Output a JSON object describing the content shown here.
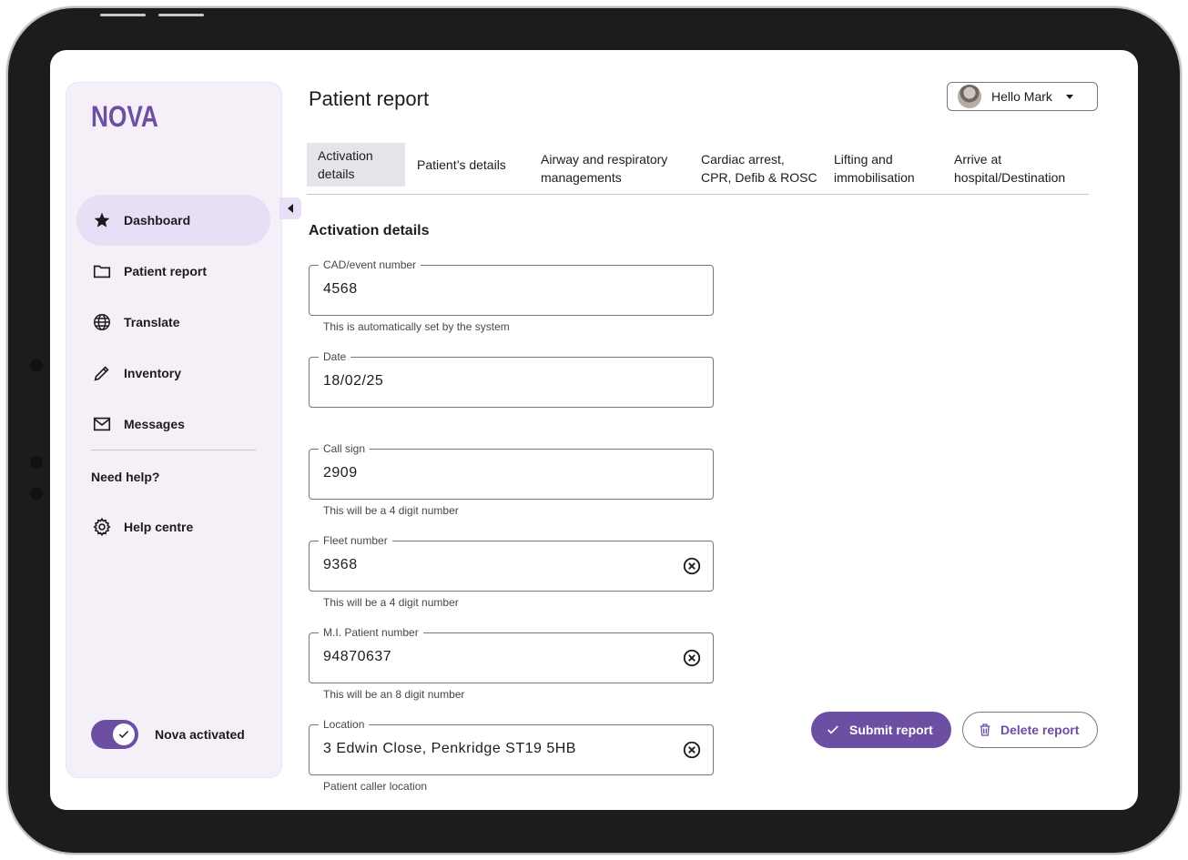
{
  "app": {
    "logo": "NOVA"
  },
  "sidebar": {
    "items": [
      {
        "label": "Dashboard",
        "icon": "star-icon",
        "active": true
      },
      {
        "label": "Patient report",
        "icon": "folder-icon"
      },
      {
        "label": "Translate",
        "icon": "globe-icon"
      },
      {
        "label": "Inventory",
        "icon": "pencil-icon"
      },
      {
        "label": "Messages",
        "icon": "mail-icon"
      }
    ],
    "need_help": "Need help?",
    "help_centre": {
      "label": "Help centre",
      "icon": "gear-icon"
    },
    "toggle": {
      "label": "Nova activated",
      "on": true
    }
  },
  "header": {
    "title": "Patient report",
    "user_greeting": "Hello Mark"
  },
  "tabs": [
    {
      "label": "Activation\ndetails",
      "active": true
    },
    {
      "label": "Patient’s details"
    },
    {
      "label": "Airway and respiratory\nmanagements"
    },
    {
      "label": "Cardiac arrest,\nCPR, Defib & ROSC"
    },
    {
      "label": "Lifting and\nimmobilisation"
    },
    {
      "label": "Arrive at\nhospital/Destination"
    }
  ],
  "section_title": "Activation details",
  "fields": {
    "cad": {
      "label": "CAD/event number",
      "value": "4568",
      "helper": "This is automatically set by the system"
    },
    "date": {
      "label": "Date",
      "value": "18/02/25"
    },
    "call_sign": {
      "label": "Call sign",
      "value": "2909",
      "helper": "This will be a 4 digit number"
    },
    "fleet": {
      "label": "Fleet number",
      "value": "9368",
      "helper": "This will be a 4 digit number"
    },
    "mi_patient": {
      "label": "M.I. Patient number",
      "value": "94870637",
      "helper": "This will be an 8 digit number"
    },
    "location": {
      "label": "Location",
      "value": "3 Edwin Close, Penkridge ST19 5HB",
      "helper": "Patient caller location"
    }
  },
  "actions": {
    "submit": "Submit report",
    "delete": "Delete report"
  },
  "colors": {
    "accent": "#6c4fa3",
    "sidebar_bg": "#f5eff8",
    "active_nav": "#e8def6"
  }
}
